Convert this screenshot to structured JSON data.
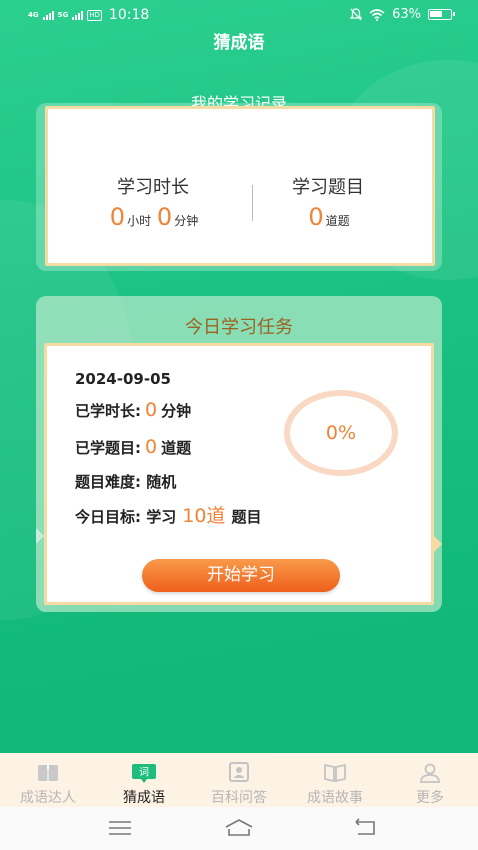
{
  "status_bar": {
    "signal1": "4G",
    "signal2": "5G",
    "hd": "HD",
    "time": "10:18",
    "battery": "63%",
    "battery_level": 0.63
  },
  "app": {
    "title": "猜成语"
  },
  "record": {
    "title": "我的学习记录",
    "duration_label": "学习时长",
    "hours": "0",
    "hours_unit": "小时",
    "minutes": "0",
    "minutes_unit": "分钟",
    "questions_label": "学习题目",
    "questions": "0",
    "questions_unit": "道题"
  },
  "task": {
    "title": "今日学习任务",
    "date": "2024-09-05",
    "studied_time_label": "已学时长:",
    "studied_time_value": "0",
    "studied_time_unit": "分钟",
    "studied_questions_label": "已学题目:",
    "studied_questions_value": "0",
    "studied_questions_unit": "道题",
    "difficulty_label": "题目难度:",
    "difficulty_value": "随机",
    "goal_label": "今日目标:",
    "goal_prefix": "学习",
    "goal_value": "10道",
    "goal_suffix": "题目",
    "progress": "0%",
    "start_button": "开始学习"
  },
  "tabs": [
    {
      "label": "成语达人",
      "icon": "book-icon",
      "active": false
    },
    {
      "label": "猜成语",
      "icon": "word-icon",
      "icon_text": "词",
      "active": true
    },
    {
      "label": "百科问答",
      "icon": "person-card-icon",
      "active": false
    },
    {
      "label": "成语故事",
      "icon": "open-book-icon",
      "active": false
    },
    {
      "label": "更多",
      "icon": "user-icon",
      "active": false
    }
  ],
  "colors": {
    "accent": "#f08336",
    "green": "#1cc283",
    "task_title": "#9b6321",
    "card_border": "#f5dca2"
  }
}
